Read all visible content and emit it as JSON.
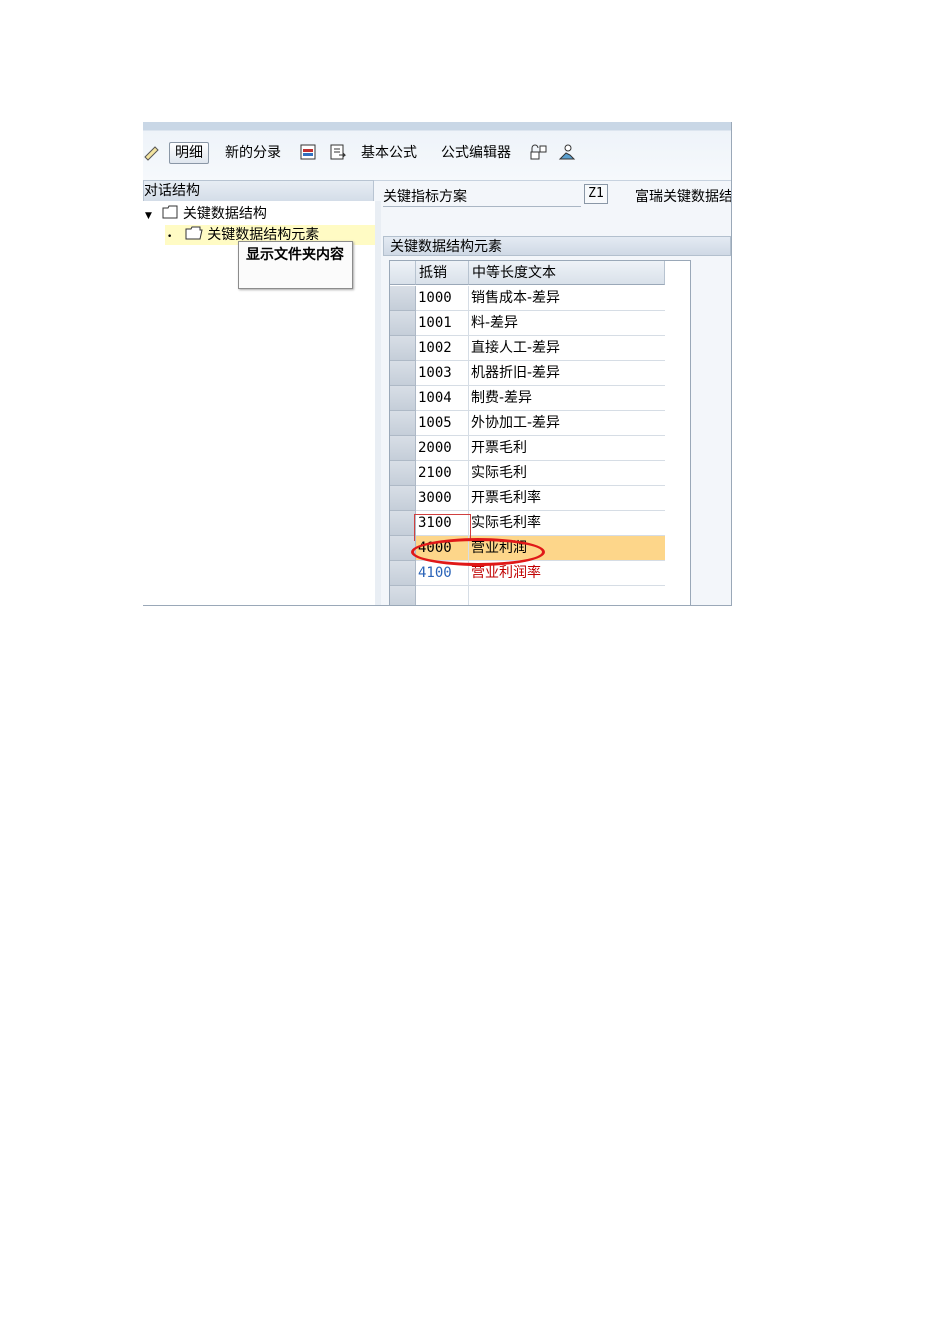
{
  "toolbar": {
    "detail_label": "明细",
    "new_entry_label": "新的分录",
    "basic_formula_label": "基本公式",
    "formula_editor_label": "公式编辑器"
  },
  "tree": {
    "header": "对话结构",
    "root": "关键数据结构",
    "child": "关键数据结构元素",
    "tooltip": "显示文件夹内容"
  },
  "key": {
    "label": "关键指标方案",
    "value": "Z1",
    "description": "富瑞关键数据结"
  },
  "panel": {
    "title": "关键数据结构元素",
    "columns": [
      "抵销",
      "中等长度文本"
    ],
    "rows": [
      {
        "code": "1000",
        "text": "销售成本-差异"
      },
      {
        "code": "1001",
        "text": "料-差异"
      },
      {
        "code": "1002",
        "text": "直接人工-差异"
      },
      {
        "code": "1003",
        "text": "机器折旧-差异"
      },
      {
        "code": "1004",
        "text": "制费-差异"
      },
      {
        "code": "1005",
        "text": "外协加工-差异"
      },
      {
        "code": "2000",
        "text": "开票毛利"
      },
      {
        "code": "2100",
        "text": "实际毛利"
      },
      {
        "code": "3000",
        "text": "开票毛利率"
      },
      {
        "code": "3100",
        "text": "实际毛利率"
      },
      {
        "code": "4000",
        "text": "营业利润"
      },
      {
        "code": "4100",
        "text": "营业利润率"
      },
      {
        "code": "",
        "text": ""
      }
    ]
  },
  "icons": [
    "edit-icon",
    "save-local-icon",
    "export-icon",
    "lock-icon",
    "user-icon",
    "folder-icon",
    "scroll-up-icon",
    "scroll-down-icon",
    "table-layout-icon"
  ],
  "colors": {
    "highlight": "#fdd68a",
    "selection": "#fffbc4",
    "annotation": "#e01818",
    "link_blue": "#2a63b8",
    "red_text": "#c00000"
  }
}
